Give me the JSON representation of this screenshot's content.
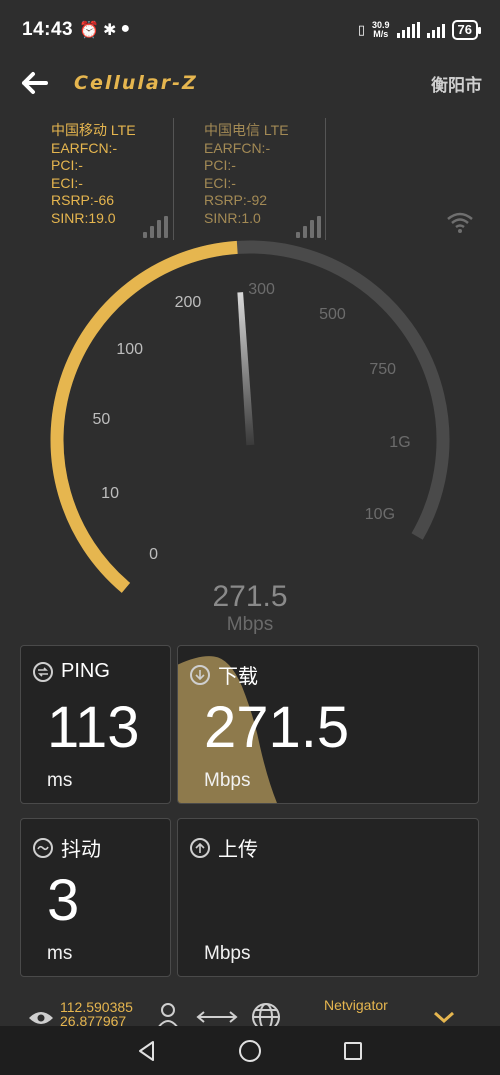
{
  "statusbar": {
    "time": "14:43",
    "speed_value": "30.9",
    "speed_unit": "M/s",
    "battery": "76"
  },
  "header": {
    "title": "Cellular-Z",
    "city": "衡阳市"
  },
  "sim1": {
    "name": "中国移动 LTE",
    "earfcn": "EARFCN:-",
    "pci": "PCI:-",
    "eci": "ECI:-",
    "rsrp": "RSRP:-66",
    "sinr": "SINR:19.0"
  },
  "sim2": {
    "name": "中国电信 LTE",
    "earfcn": "EARFCN:-",
    "pci": "PCI:-",
    "eci": "ECI:-",
    "rsrp": "RSRP:-92",
    "sinr": "SINR:1.0"
  },
  "gauge": {
    "labels": [
      "0",
      "10",
      "50",
      "100",
      "200",
      "300",
      "500",
      "750",
      "1G",
      "10G"
    ],
    "active_label_count": 5,
    "value": "271.5",
    "unit": "Mbps",
    "accent_color": "#e6b64f",
    "track_color": "#4a4a4a"
  },
  "cards": {
    "ping": {
      "label": "PING",
      "value": "113",
      "unit": "ms"
    },
    "download": {
      "label": "下载",
      "value": "271.5",
      "unit": "Mbps"
    },
    "jitter": {
      "label": "抖动",
      "value": "3",
      "unit": "ms"
    },
    "upload": {
      "label": "上传",
      "value": "",
      "unit": "Mbps"
    }
  },
  "footer": {
    "lon": "112.590385",
    "lat": "26.877967",
    "operator": "Netvigator"
  },
  "icons": {
    "back": "arrow-left-icon",
    "ping": "ping-icon",
    "download": "download-icon",
    "jitter": "jitter-icon",
    "upload": "upload-icon",
    "wifi": "wifi-icon",
    "eye": "eye-icon",
    "person": "person-icon",
    "transfer": "transfer-icon",
    "globe": "globe-icon",
    "expand": "chevron-down-icon"
  }
}
